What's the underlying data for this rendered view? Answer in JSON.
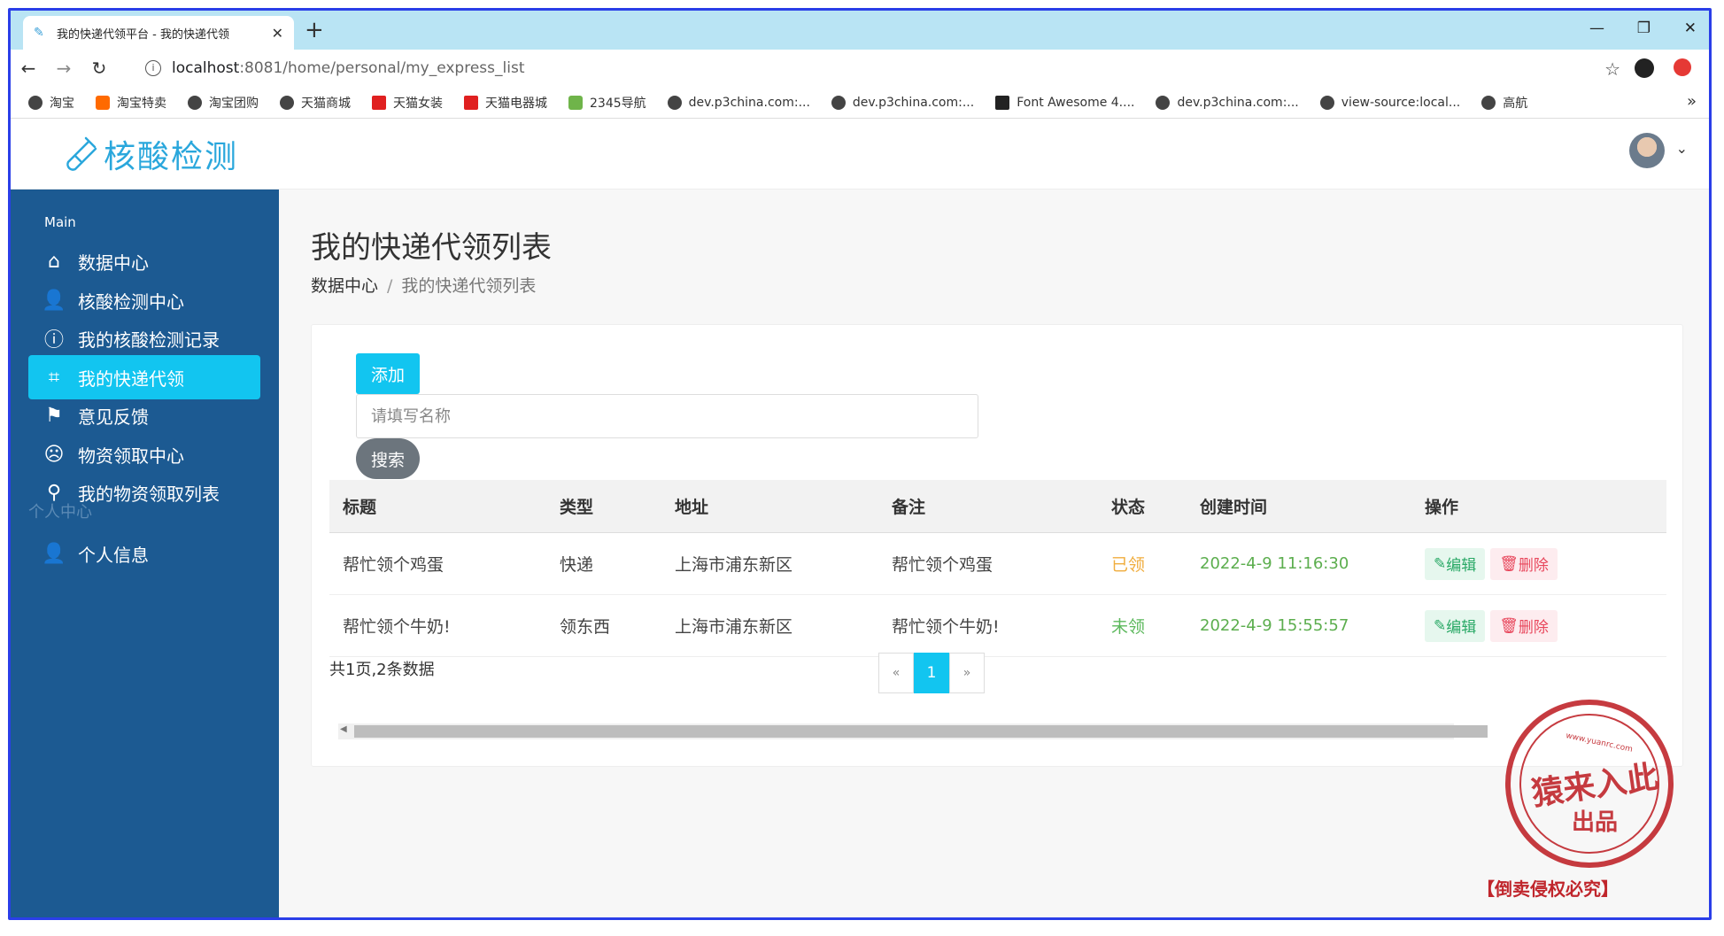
{
  "browser": {
    "tab_title": "我的快递代领平台 - 我的快递代领",
    "url_host": "localhost",
    "url_path": ":8081/home/personal/my_express_list",
    "bookmarks": [
      {
        "label": "淘宝",
        "icon": "globe-icon"
      },
      {
        "label": "淘宝特卖",
        "icon": "taobao-icon"
      },
      {
        "label": "淘宝团购",
        "icon": "globe-icon"
      },
      {
        "label": "天猫商城",
        "icon": "globe-icon"
      },
      {
        "label": "天猫女装",
        "icon": "tmall-icon"
      },
      {
        "label": "天猫电器城",
        "icon": "jd-icon"
      },
      {
        "label": "2345导航",
        "icon": "2345-icon"
      },
      {
        "label": "dev.p3china.com:...",
        "icon": "globe-icon"
      },
      {
        "label": "dev.p3china.com:...",
        "icon": "globe-icon"
      },
      {
        "label": "Font Awesome 4....",
        "icon": "fontawesome-icon"
      },
      {
        "label": "dev.p3china.com:...",
        "icon": "globe-icon"
      },
      {
        "label": "view-source:local...",
        "icon": "globe-icon"
      },
      {
        "label": "高航",
        "icon": "globe-icon"
      }
    ],
    "bookmarks_more": "»"
  },
  "app": {
    "logo_text": "核酸检测",
    "sidebar": {
      "group_main": "Main",
      "items": [
        {
          "label": "数据中心",
          "icon": "home-icon"
        },
        {
          "label": "核酸检测中心",
          "icon": "user-plus-icon"
        },
        {
          "label": "我的核酸检测记录",
          "icon": "alert-circle-icon"
        },
        {
          "label": "我的快递代领",
          "icon": "vector-square-icon",
          "active": true
        },
        {
          "label": "意见反馈",
          "icon": "flag-icon"
        },
        {
          "label": "物资领取中心",
          "icon": "sad-face-icon"
        },
        {
          "label": "我的物资领取列表",
          "icon": "map-pin-icon"
        }
      ],
      "group_personal": "个人中心",
      "personal_items": [
        {
          "label": "个人信息",
          "icon": "user-plus-icon"
        }
      ]
    }
  },
  "main": {
    "title": "我的快递代领列表",
    "breadcrumb": {
      "root": "数据中心",
      "sep": "/",
      "current": "我的快递代领列表"
    },
    "add_label": "添加",
    "search_placeholder": "请填写名称",
    "search_label": "搜索",
    "table": {
      "headers": [
        "标题",
        "类型",
        "地址",
        "备注",
        "状态",
        "创建时间",
        "操作"
      ],
      "rows": [
        {
          "title": "帮忙领个鸡蛋",
          "type": "快递",
          "address": "上海市浦东新区",
          "note": "帮忙领个鸡蛋",
          "status": "已领",
          "created": "2022-4-9 11:16:30"
        },
        {
          "title": "帮忙领个牛奶!",
          "type": "领东西",
          "address": "上海市浦东新区",
          "note": "帮忙领个牛奶!",
          "status": "未领",
          "created": "2022-4-9 15:55:57"
        }
      ],
      "edit_label": "编辑",
      "delete_label": "删除"
    },
    "summary": "共1页,2条数据",
    "pager": {
      "prev": "«",
      "current": "1",
      "next": "»"
    }
  },
  "watermark": {
    "url": "www.yuanrc.com",
    "line1": "猿来入此",
    "line2": "出品",
    "caption": "【倒卖侵权必究】"
  }
}
